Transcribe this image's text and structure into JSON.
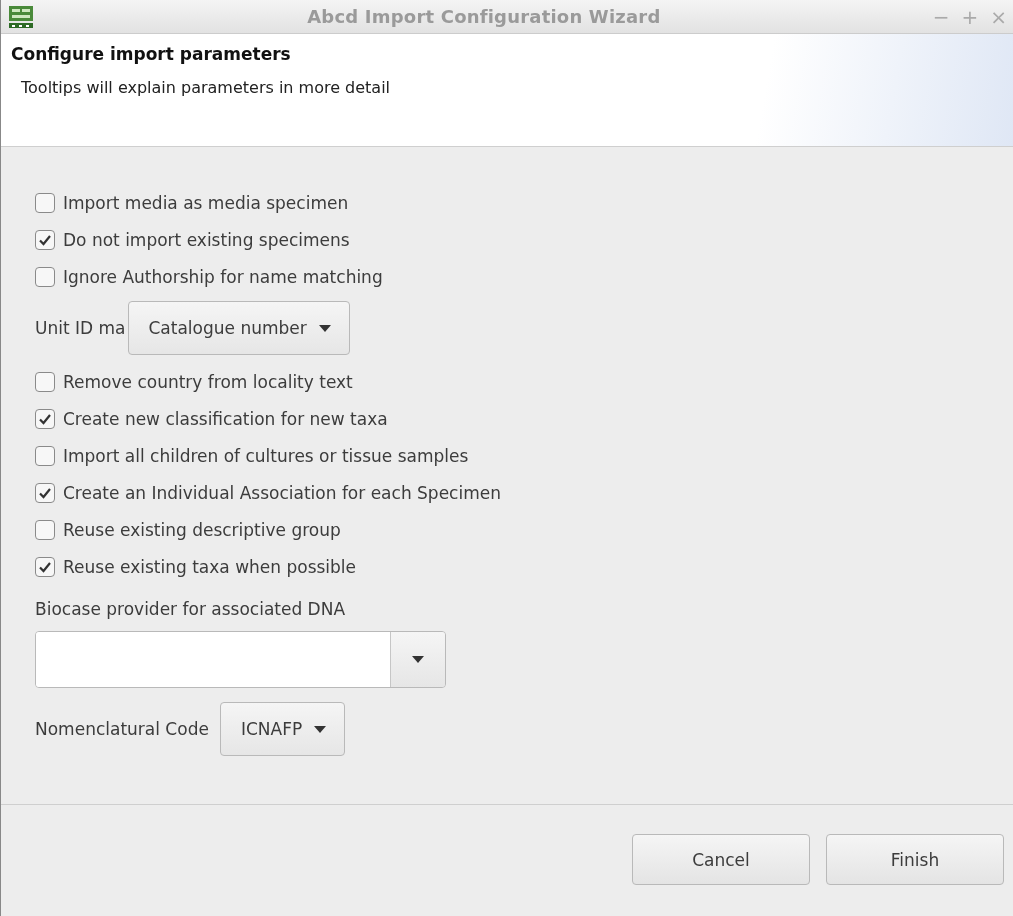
{
  "window": {
    "title": "Abcd Import Configuration Wizard",
    "controls": [
      "−",
      "+",
      "×"
    ]
  },
  "header": {
    "title": "Configure import parameters",
    "description": "Tooltips will explain parameters in more detail"
  },
  "options": [
    {
      "kind": "checkbox",
      "label": "Import media as media specimen",
      "checked": false
    },
    {
      "kind": "checkbox",
      "label": "Do not import existing specimens",
      "checked": true
    },
    {
      "kind": "checkbox",
      "label": "Ignore Authorship for name matching",
      "checked": false
    },
    {
      "kind": "combo",
      "label": "Unit ID ma",
      "value": "Catalogue number"
    },
    {
      "kind": "checkbox",
      "label": "Remove country from locality text",
      "checked": false
    },
    {
      "kind": "checkbox",
      "label": "Create new classification for new taxa",
      "checked": true
    },
    {
      "kind": "checkbox",
      "label": "Import all children of cultures or tissue samples",
      "checked": false
    },
    {
      "kind": "checkbox",
      "label": "Create an Individual Association for each Specimen",
      "checked": true
    },
    {
      "kind": "checkbox",
      "label": "Reuse existing descriptive group",
      "checked": false
    },
    {
      "kind": "checkbox",
      "label": "Reuse existing taxa when possible",
      "checked": true
    },
    {
      "kind": "entry-combo",
      "label": "Biocase provider for associated DNA"
    },
    {
      "kind": "combo",
      "label": "Nomenclatural Code",
      "value": "ICNAFP"
    }
  ],
  "buttons": [
    {
      "label": "Cancel"
    },
    {
      "label": "Finish"
    }
  ]
}
